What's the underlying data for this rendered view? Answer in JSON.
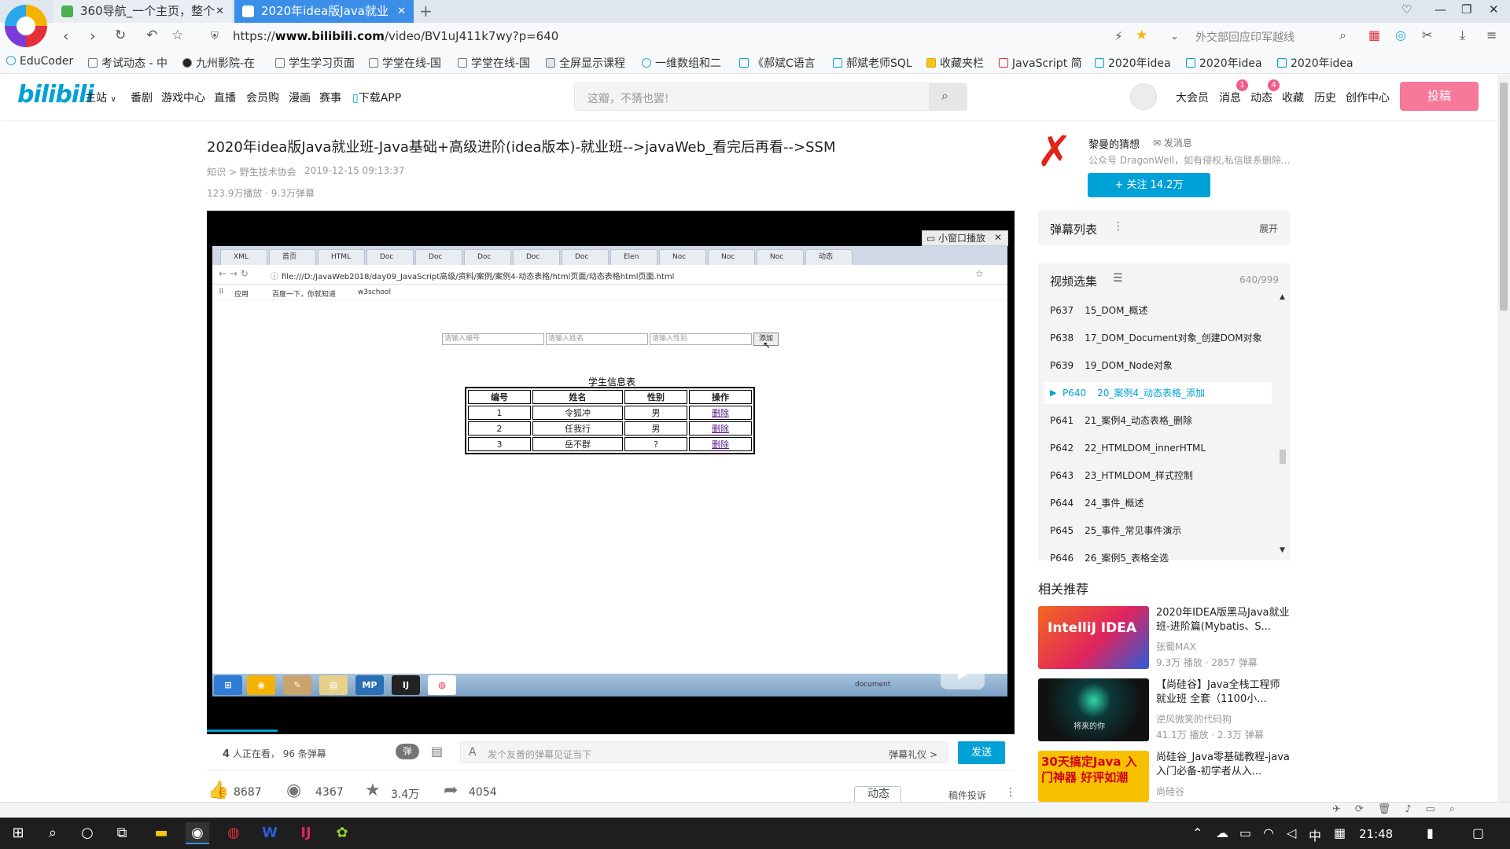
{
  "browser": {
    "tabs": [
      {
        "label": "360导航_一个主页，整个"
      },
      {
        "label": "2020年idea版Java就业"
      }
    ],
    "url_prefix": "https://",
    "url_domain": "www.bilibili.com",
    "url_path": "/video/BV1uJ411k7wy?p=640",
    "search_hint": "外交部回应印军越线",
    "bookmarks": [
      "EduCoder",
      "考试动态 - 中",
      "九州影院-在",
      "学生学习页面",
      "学堂在线-国",
      "学堂在线-国",
      "全屏显示课程",
      "一维数组和二",
      "《郝斌C语言",
      "郝斌老师SQL",
      "收藏夹栏",
      "JavaScript 简",
      "2020年idea",
      "2020年idea",
      "2020年idea"
    ]
  },
  "site": {
    "logo": "bilibili",
    "nav": [
      "主站",
      "番剧",
      "游戏中心",
      "直播",
      "会员购",
      "漫画",
      "赛事",
      "下载APP"
    ],
    "search_placeholder": "这瓣，不猜也罢!",
    "right_nav": [
      "大会员",
      "消息",
      "动态",
      "收藏",
      "历史",
      "创作中心"
    ],
    "msg_badge": "1",
    "dyn_badge": "4",
    "upload": "投稿"
  },
  "video": {
    "title": "2020年idea版Java就业班-Java基础+高级进阶(idea版本)-就业班-->javaWeb_看完后再看-->SSM",
    "category": "知识 > 野生技术协会",
    "date": "2019-12-15 09:13:37",
    "stats": "123.9万播放 · 9.3万弹幕",
    "viewers_count": "4",
    "viewers_text": "人正在看，",
    "danmaku_count": "96 条弹幕",
    "danmaku_placeholder": "发个友善的弹幕见证当下",
    "danmaku_etiquette": "弹幕礼仪 >",
    "send": "发送",
    "likes": "8687",
    "coins": "4367",
    "favs": "3.4万",
    "shares": "4054",
    "report": "稿件投诉",
    "mini_window": "小窗口播放"
  },
  "inner": {
    "tabs": [
      "XML",
      "首页",
      "HTML",
      "Doc",
      "Doc",
      "Doc",
      "Doc",
      "Doc",
      "Elen",
      "Noc",
      "Noc",
      "Noc",
      "动态",
      "动态"
    ],
    "url": "file:///D:/JavaWeb2018/day09_JavaScript高级/资料/案例/案例4-动态表格/html页面/动态表格html页面.html",
    "bookmarks": [
      "应用",
      "百度一下，你就知道",
      "w3school"
    ],
    "inputs": [
      "请输入编号",
      "请输入姓名",
      "请输入性别"
    ],
    "add": "添加",
    "caption": "学生信息表",
    "headers": [
      "编号",
      "姓名",
      "性别",
      "操作"
    ],
    "rows": [
      [
        "1",
        "令狐冲",
        "男",
        "删除"
      ],
      [
        "2",
        "任我行",
        "男",
        "删除"
      ],
      [
        "3",
        "岳不群",
        "?",
        "删除"
      ]
    ],
    "taskbar_label": "document"
  },
  "up": {
    "name": "黎曼的猜想",
    "message": "发消息",
    "desc": "公众号 DragonWell，如有侵权,私信联系删除...",
    "follow": "+ 关注 14.2万"
  },
  "danmaku_list": {
    "title": "弹幕列表",
    "expand": "展开"
  },
  "episodes": {
    "title": "视频选集",
    "count": "640/999",
    "items": [
      {
        "p": "P637",
        "name": "15_DOM_概述"
      },
      {
        "p": "P638",
        "name": "17_DOM_Document对象_创建DOM对象"
      },
      {
        "p": "P639",
        "name": "19_DOM_Node对象"
      },
      {
        "p": "P640",
        "name": "20_案例4_动态表格_添加"
      },
      {
        "p": "P641",
        "name": "21_案例4_动态表格_删除"
      },
      {
        "p": "P642",
        "name": "22_HTMLDOM_innerHTML"
      },
      {
        "p": "P643",
        "name": "23_HTMLDOM_样式控制"
      },
      {
        "p": "P644",
        "name": "24_事件_概述"
      },
      {
        "p": "P645",
        "name": "25_事件_常见事件演示"
      },
      {
        "p": "P646",
        "name": "26_案例5_表格全选"
      }
    ]
  },
  "related": {
    "title": "相关推荐",
    "items": [
      {
        "title": "2020年IDEA版黑马Java就业班-进阶篇(Mybatis、S...",
        "author": "张蜀MAX",
        "stats": "9.3万 播放 · 2857 弹幕",
        "thumb": "IntelliJ IDEA"
      },
      {
        "title": "【尚硅谷】Java全栈工程师就业班 全套（1100小...",
        "author": "逆风微笑的代码狗",
        "stats": "41.1万 播放 · 2.3万 弹幕",
        "thumb": "将来的你"
      },
      {
        "title": "尚硅谷_Java零基础教程-java入门必备-初学者从入...",
        "author": "尚硅谷",
        "stats": "",
        "thumb": "30天搞定Java 入门神器 好评如潮"
      }
    ]
  },
  "system": {
    "clock": "21:48",
    "ime": "中"
  },
  "colors": {
    "accent": "#00a1d6",
    "upload": "#f7799a",
    "tab_active": "#3b8ee8"
  }
}
